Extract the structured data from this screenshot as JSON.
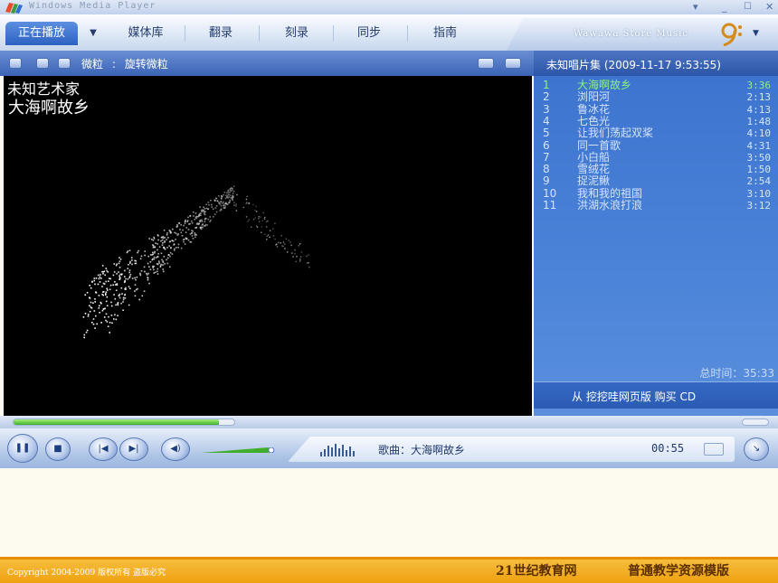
{
  "window": {
    "title": "Windows Media Player",
    "minimize": "_",
    "close": "✕",
    "menu": "▾"
  },
  "tabs": [
    {
      "label": "正在播放",
      "active": true
    },
    {
      "label": "媒体库"
    },
    {
      "label": "翻录"
    },
    {
      "label": "刻录"
    },
    {
      "label": "同步"
    },
    {
      "label": "指南"
    }
  ],
  "store": {
    "label": "Wawawa Store Music"
  },
  "visualization": {
    "name": "微粒",
    "separator": ":",
    "preset": "旋转微粒"
  },
  "video": {
    "artist": "未知艺术家",
    "song": "大海啊故乡"
  },
  "playlist": {
    "header": "未知唱片集 (2009-11-17 9:53:55)",
    "tracks": [
      {
        "num": "1",
        "title": "大海啊故乡",
        "duration": "3:36",
        "current": true
      },
      {
        "num": "2",
        "title": "浏阳河",
        "duration": "2:13"
      },
      {
        "num": "3",
        "title": "鲁冰花",
        "duration": "4:13"
      },
      {
        "num": "4",
        "title": "七色光",
        "duration": "1:48"
      },
      {
        "num": "5",
        "title": "让我们荡起双桨",
        "duration": "4:10"
      },
      {
        "num": "6",
        "title": "同一首歌",
        "duration": "4:31"
      },
      {
        "num": "7",
        "title": "小白船",
        "duration": "3:50"
      },
      {
        "num": "8",
        "title": "雪绒花",
        "duration": "1:50"
      },
      {
        "num": "9",
        "title": "捉泥鳅",
        "duration": "2:54"
      },
      {
        "num": "10",
        "title": "我和我的祖国",
        "duration": "3:10"
      },
      {
        "num": "11",
        "title": "洪湖水浪打浪",
        "duration": "3:12"
      }
    ],
    "total_label": "总时间：35:33",
    "buy_label": "从 挖挖哇网页版 购买 CD"
  },
  "player": {
    "seek_progress": 0.93,
    "volume_level": 0.85,
    "now_playing_label": "歌曲：大海啊故乡",
    "elapsed": "00:55"
  },
  "icons": {
    "pause": "pause-icon",
    "stop": "stop-icon",
    "prev": "previous-icon",
    "next": "next-icon",
    "mute": "mute-icon"
  },
  "footer": {
    "copyright": "Copyright 2004-2009 版权所有 盗版必究",
    "brand": "21世纪教育网",
    "brand2": "普通教学资源模版"
  },
  "colors": {
    "accent": "#3a63b6",
    "playlist_current": "#8df27c",
    "footer": "#efa10f"
  }
}
